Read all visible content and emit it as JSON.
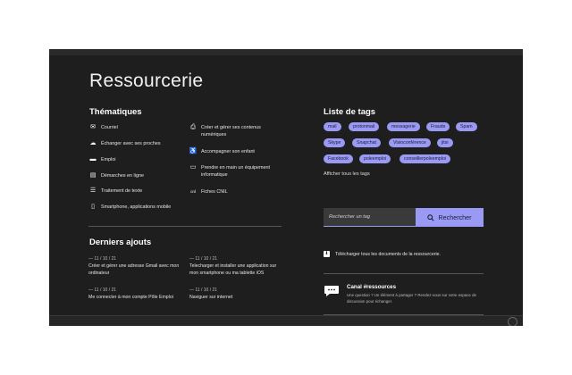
{
  "title": "Ressourcerie",
  "thematiques": {
    "heading": "Thématiques",
    "col1": [
      {
        "icon": "mail-icon",
        "glyph": "✉",
        "label": "Courriel"
      },
      {
        "icon": "chat-icon",
        "glyph": "☁",
        "label": "Échanger avec ses proches"
      },
      {
        "icon": "briefcase-icon",
        "glyph": "▬",
        "label": "Emploi"
      },
      {
        "icon": "document-icon",
        "glyph": "▤",
        "label": "Démarches en ligne"
      },
      {
        "icon": "text-editor-icon",
        "glyph": "☰",
        "label": "Traitement de texte"
      },
      {
        "icon": "smartphone-icon",
        "glyph": "▯",
        "label": "Smartphone, applications mobile"
      }
    ],
    "col2": [
      {
        "icon": "content-icon",
        "glyph": "⎙",
        "label": "Créer et gérer ses contenus numériques"
      },
      {
        "icon": "accompany-icon",
        "glyph": "♿",
        "label": "Accompagner son enfant"
      },
      {
        "icon": "computer-icon",
        "glyph": "▭",
        "label": "Prendre en main un équipement informatique"
      },
      {
        "icon": "cnil-icon",
        "glyph": "cnl",
        "label": "Fiches CNIL"
      }
    ]
  },
  "ajouts": {
    "heading": "Derniers ajouts",
    "items": [
      {
        "date": "— 11 / 10 / 21",
        "title": "Créer et gérer une adresse Gmail avec mon ordinateur"
      },
      {
        "date": "— 11 / 10 / 21",
        "title": "Telecharger et installer une application sur mon smartphone ou ma tablette iOS"
      },
      {
        "date": "— 11 / 10 / 21",
        "title": "Me connecter à mon compte Pôle Emploi"
      },
      {
        "date": "— 11 / 10 / 21",
        "title": "Naviguer sur internet"
      }
    ]
  },
  "tags": {
    "heading": "Liste de tags",
    "items": [
      "mail",
      "protonmail",
      "messagerie",
      "Fraude",
      "Spam",
      "Skype",
      "Snapchat",
      "Visioconférence",
      "jitsi",
      "Facebook",
      "poleemploi",
      "conseillerpoleemploi"
    ],
    "all_link": "Afficher tous les tags"
  },
  "search": {
    "placeholder": "Rechercher un tag",
    "button": "Rechercher"
  },
  "download": {
    "label": "Télécharger tous les documents de la ressourcerie."
  },
  "canal": {
    "title": "Canal #ressources",
    "desc": "Une question ? Un élément à partager ? Rendez-vous sur votre espace de discussion pour échanger."
  },
  "colors": {
    "accent": "#9a9af5",
    "background": "#1e1e1e"
  }
}
